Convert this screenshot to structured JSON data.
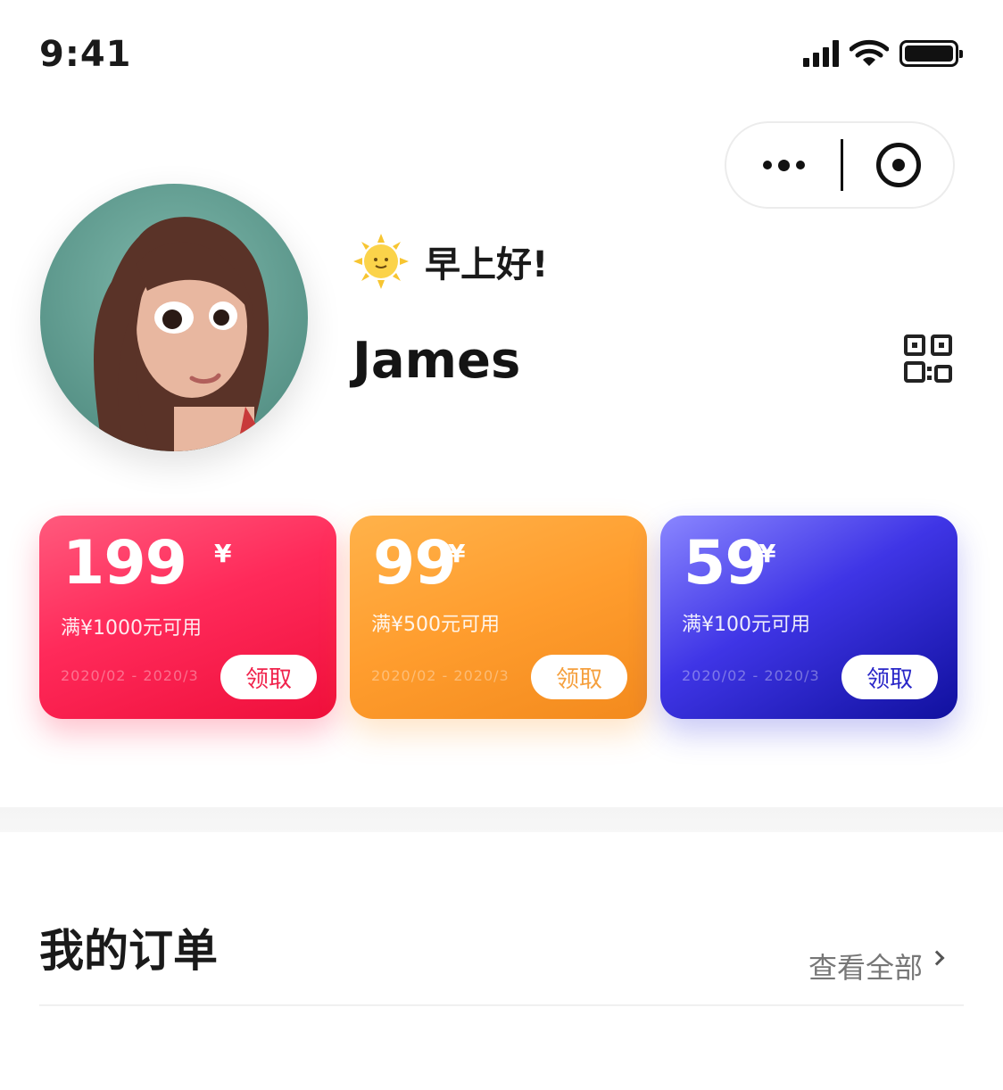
{
  "status_bar": {
    "time": "9:41"
  },
  "profile": {
    "greeting": "早上好!",
    "username": "James"
  },
  "coupons": [
    {
      "amount": "199",
      "currency": "¥",
      "condition": "满¥1000元可用",
      "dates": "2020/02 - 2020/3",
      "action": "领取",
      "color": "#ff2a5a"
    },
    {
      "amount": "99",
      "currency": "¥",
      "condition": "满¥500元可用",
      "dates": "2020/02 - 2020/3",
      "action": "领取",
      "color": "#ff9d2e"
    },
    {
      "amount": "59",
      "currency": "¥",
      "condition": "满¥100元可用",
      "dates": "2020/02 - 2020/3",
      "action": "领取",
      "color": "#2a27c8"
    }
  ],
  "orders": {
    "title": "我的订单",
    "view_all": "查看全部"
  },
  "icons": {
    "signal": "signal-icon",
    "wifi": "wifi-icon",
    "battery": "battery-icon",
    "more": "more-dots-icon",
    "close_target": "target-icon",
    "sun": "sun-icon",
    "qr": "qr-code-icon",
    "chevron": "chevron-right-icon"
  }
}
